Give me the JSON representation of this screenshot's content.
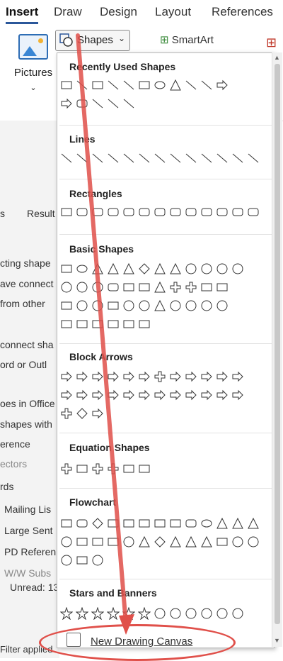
{
  "ribbon": {
    "tabs": [
      "Insert",
      "Draw",
      "Design",
      "Layout",
      "References"
    ],
    "pictures_label": "Pictures",
    "shapes_label": "Shapes",
    "smartart_label": "SmartArt"
  },
  "background_lines": [
    "s",
    "Result",
    "cting shape",
    "ave connect",
    "from other",
    "connect sha",
    "ord or Outl",
    "oes in Office",
    "shapes with",
    "erence",
    "ectors",
    "rds",
    "Mailing Lis",
    "Large Sent",
    "PD Referen",
    "W/W Subs",
    "Unread: 13",
    "Filter applied"
  ],
  "shapes_menu": {
    "sections": [
      {
        "title": "Recently Used Shapes"
      },
      {
        "title": "Lines"
      },
      {
        "title": "Rectangles"
      },
      {
        "title": "Basic Shapes"
      },
      {
        "title": "Block Arrows"
      },
      {
        "title": "Equation Shapes"
      },
      {
        "title": "Flowchart"
      },
      {
        "title": "Stars and Banners"
      }
    ],
    "new_canvas_label": "New Drawing Canvas"
  },
  "colors": {
    "accent": "#2b579a",
    "annotation": "#e0504a"
  }
}
